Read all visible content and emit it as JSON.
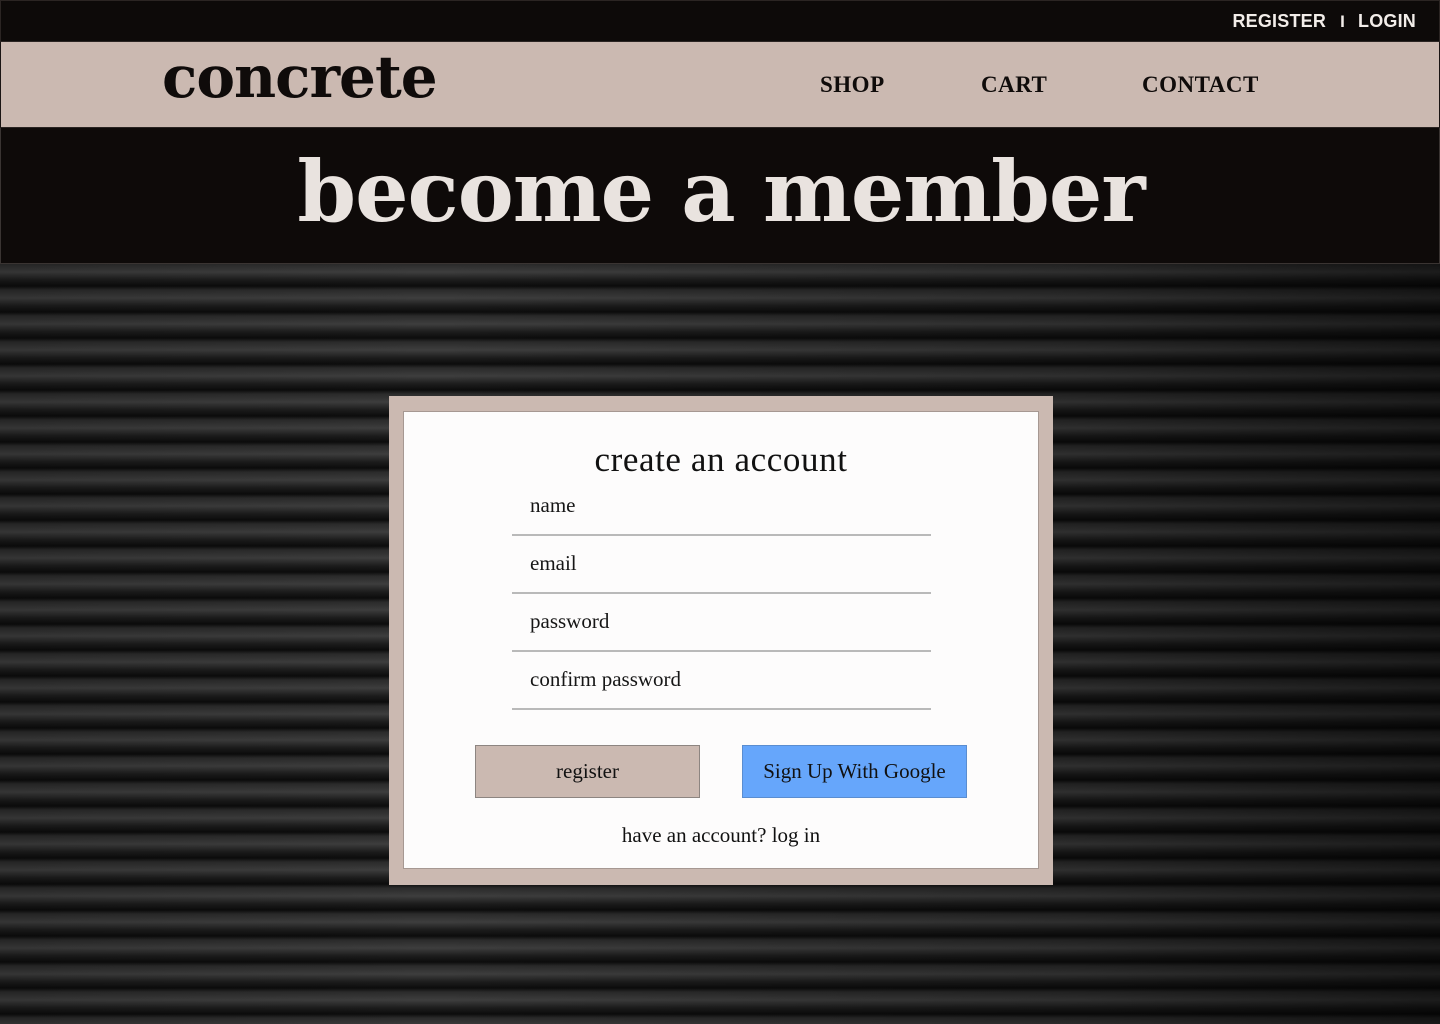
{
  "topbar": {
    "register_label": "REGISTER",
    "separator": "I",
    "login_label": "LOGIN"
  },
  "navbar": {
    "logo": "concrete",
    "links": [
      {
        "label": "SHOP"
      },
      {
        "label": "CART"
      },
      {
        "label": "CONTACT"
      }
    ]
  },
  "hero": {
    "title": "become a member"
  },
  "form": {
    "title": "create an account",
    "fields": [
      {
        "placeholder": "name",
        "value": ""
      },
      {
        "placeholder": "email",
        "value": ""
      },
      {
        "placeholder": "password",
        "value": ""
      },
      {
        "placeholder": "confirm password",
        "value": ""
      }
    ],
    "register_label": "register",
    "google_label": "Sign Up With Google",
    "login_prompt": "have an account? log in"
  },
  "colors": {
    "dark": "#0e0a09",
    "accent_tan": "#cbb9b1",
    "google_blue": "#66a6fb",
    "card_bg": "#fdfcfc"
  }
}
